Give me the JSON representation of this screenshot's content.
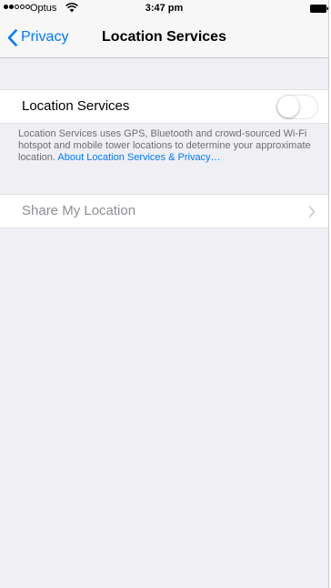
{
  "status_bar": {
    "carrier": "Optus",
    "time": "3:47 pm",
    "signal_bars_filled": 2,
    "signal_bars_total": 5,
    "icons": [
      "signal-dots-icon",
      "wifi-icon",
      "battery-icon"
    ]
  },
  "nav": {
    "back_label": "Privacy",
    "title": "Location Services"
  },
  "location_services": {
    "label": "Location Services",
    "toggle_on": false,
    "footer_text": "Location Services uses GPS, Bluetooth and crowd-sourced Wi-Fi hotspot and mobile tower locations to determine your approximate location. ",
    "footer_link": "About Location Services & Privacy…"
  },
  "share_my_location": {
    "label": "Share My Location",
    "enabled": false
  },
  "colors": {
    "accent": "#007aff",
    "background": "#efeff4",
    "disabled_text": "#8e8e93",
    "footer_text": "#6d6d72"
  }
}
